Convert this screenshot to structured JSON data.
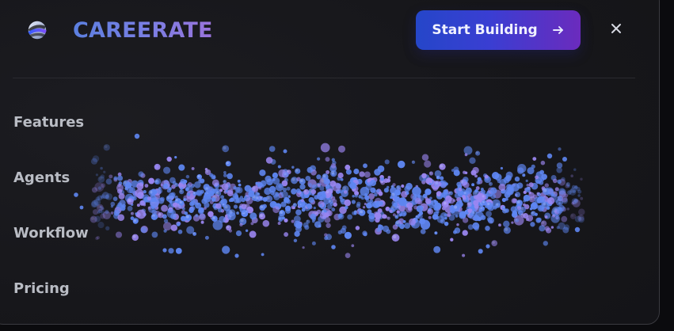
{
  "header": {
    "brand_name": "CAREERATE",
    "cta_label": "Start Building",
    "cta_icon": "arrow-right-icon",
    "close_icon": "close-icon",
    "logo_icon": "globe-logo-icon"
  },
  "nav": {
    "items": [
      {
        "label": "Features"
      },
      {
        "label": "Agents"
      },
      {
        "label": "Workflow"
      },
      {
        "label": "Pricing"
      }
    ]
  },
  "colors": {
    "panel_bg": "#17171b",
    "nav_text": "#b9bcc4",
    "brand_gradient_start": "#5b7fe0",
    "brand_gradient_end": "#9a73db",
    "cta_gradient_start": "#2546c9",
    "cta_gradient_end": "#6b2bbd",
    "particle_blue": "#5e86f2",
    "particle_violet": "#9b86f2"
  }
}
